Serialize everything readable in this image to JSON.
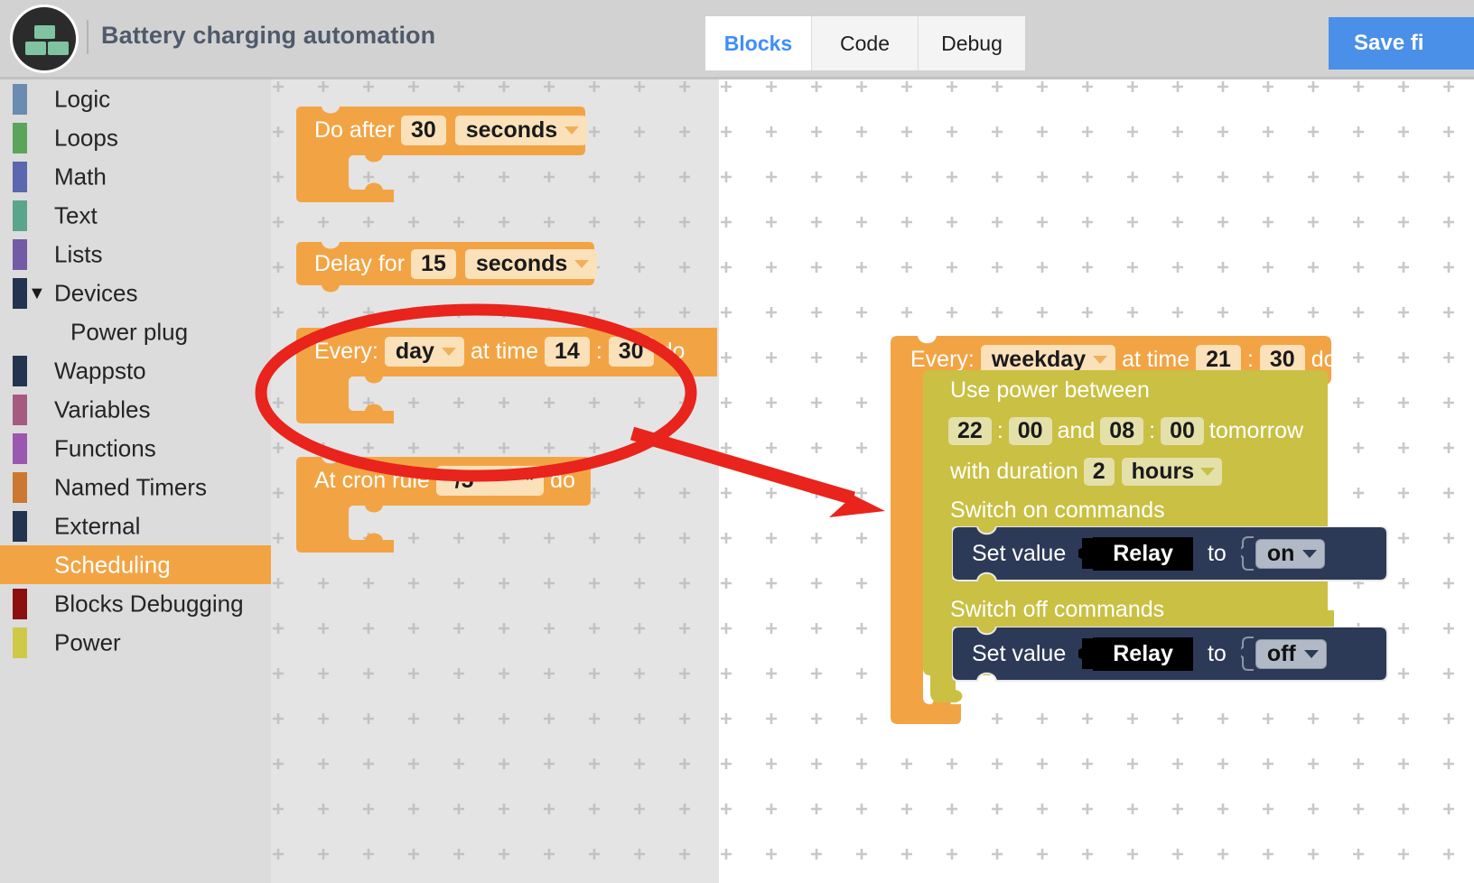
{
  "header": {
    "logo_name": "wappsto-blocks-logo",
    "title": "Battery charging automation",
    "tabs": [
      {
        "label": "Blocks",
        "active": true
      },
      {
        "label": "Code",
        "active": false
      },
      {
        "label": "Debug",
        "active": false
      }
    ],
    "save_button": "Save fi",
    "save_button_color": "#4a90e8",
    "active_tab_color": "#3f8efc"
  },
  "sidebar": {
    "items": [
      {
        "label": "Logic",
        "color": "#6b8bb0",
        "selected": false,
        "expandable": false,
        "child": false
      },
      {
        "label": "Loops",
        "color": "#5ba55b",
        "selected": false,
        "expandable": false,
        "child": false
      },
      {
        "label": "Math",
        "color": "#5b67af",
        "selected": false,
        "expandable": false,
        "child": false
      },
      {
        "label": "Text",
        "color": "#5ba58c",
        "selected": false,
        "expandable": false,
        "child": false
      },
      {
        "label": "Lists",
        "color": "#745ba5",
        "selected": false,
        "expandable": false,
        "child": false
      },
      {
        "label": "Devices",
        "color": "#23344f",
        "selected": false,
        "expandable": true,
        "child": false
      },
      {
        "label": "Power plug",
        "color": "",
        "selected": false,
        "expandable": false,
        "child": true
      },
      {
        "label": "Wappsto",
        "color": "#23344f",
        "selected": false,
        "expandable": false,
        "child": false
      },
      {
        "label": "Variables",
        "color": "#a55b80",
        "selected": false,
        "expandable": false,
        "child": false
      },
      {
        "label": "Functions",
        "color": "#9a58b0",
        "selected": false,
        "expandable": false,
        "child": false
      },
      {
        "label": "Named Timers",
        "color": "#cc7832",
        "selected": false,
        "expandable": false,
        "child": false
      },
      {
        "label": "External",
        "color": "#23344f",
        "selected": false,
        "expandable": false,
        "child": false
      },
      {
        "label": "Scheduling",
        "color": "#f2a444",
        "selected": true,
        "expandable": false,
        "child": false
      },
      {
        "label": "Blocks Debugging",
        "color": "#8c1010",
        "selected": false,
        "expandable": false,
        "child": false
      },
      {
        "label": "Power",
        "color": "#cfc948",
        "selected": false,
        "expandable": false,
        "child": false
      }
    ],
    "expand_caret": "▼",
    "selected_bg": "#f2a444"
  },
  "flyout": {
    "blocks": {
      "do_after": {
        "prefix": "Do after",
        "value": "30",
        "unit": "seconds"
      },
      "delay_for": {
        "prefix": "Delay for",
        "value": "15",
        "unit": "seconds"
      },
      "every_at_time": {
        "prefix": "Every:",
        "period": "day",
        "mid": "at time",
        "hour": "14",
        "colon": ":",
        "minute": "30",
        "suffix": "do"
      },
      "at_cron_rule": {
        "prefix": "At cron rule",
        "rule": "*/5 * * * *",
        "suffix": "do"
      }
    }
  },
  "workspace": {
    "every_block": {
      "prefix": "Every:",
      "period": "weekday",
      "mid": "at time",
      "hour": "21",
      "colon": ":",
      "minute": "30",
      "suffix": "do",
      "color": "#f2a444"
    },
    "power_block": {
      "color": "#c9c044",
      "line1": "Use power between",
      "start_hour": "22",
      "colon1": ":",
      "start_min": "00",
      "and": "and",
      "end_hour": "08",
      "colon2": ":",
      "end_min": "00",
      "tomorrow": "tomorrow",
      "duration_label": "with duration",
      "duration_value": "2",
      "duration_unit": "hours",
      "switch_on_label": "Switch on commands",
      "switch_off_label": "Switch off commands"
    },
    "set_value_on": {
      "prefix": "Set value",
      "target": "Relay",
      "to": "to",
      "value": "on",
      "color": "#2d3a57"
    },
    "set_value_off": {
      "prefix": "Set value",
      "target": "Relay",
      "to": "to",
      "value": "off",
      "color": "#2d3a57"
    }
  },
  "annotation": {
    "color": "#e8241c",
    "ellipse_name": "highlight-ellipse",
    "arrow_name": "pointer-arrow"
  }
}
